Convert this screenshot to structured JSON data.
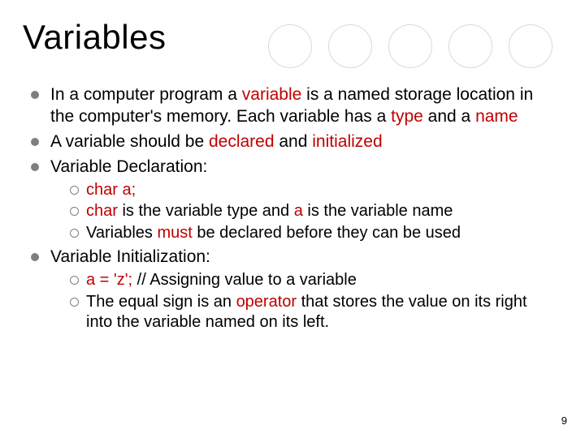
{
  "title": "Variables",
  "circles_count": 5,
  "bullets": [
    {
      "segments": [
        {
          "t": "In a computer program a "
        },
        {
          "t": "variable",
          "red": true
        },
        {
          "t": " is a named storage location in the computer's memory. Each variable has a "
        },
        {
          "t": "type",
          "red": true
        },
        {
          "t": " and a "
        },
        {
          "t": "name",
          "red": true
        }
      ]
    },
    {
      "segments": [
        {
          "t": "A variable should be "
        },
        {
          "t": "declared",
          "red": true
        },
        {
          "t": " and "
        },
        {
          "t": "initialized",
          "red": true
        }
      ]
    },
    {
      "segments": [
        {
          "t": "Variable Declaration:"
        }
      ],
      "sub": [
        {
          "segments": [
            {
              "t": "char a;",
              "red": true
            }
          ]
        },
        {
          "segments": [
            {
              "t": "char",
              "red": true
            },
            {
              "t": " is the variable type and "
            },
            {
              "t": "a",
              "red": true
            },
            {
              "t": " is the variable name"
            }
          ]
        },
        {
          "segments": [
            {
              "t": "Variables "
            },
            {
              "t": "must",
              "red": true
            },
            {
              "t": " be declared before they can be used"
            }
          ]
        }
      ]
    },
    {
      "segments": [
        {
          "t": "Variable Initialization:"
        }
      ],
      "sub": [
        {
          "segments": [
            {
              "t": "a = 'z'; ",
              "red": true
            },
            {
              "t": "// Assigning value to a variable"
            }
          ]
        },
        {
          "segments": [
            {
              "t": "The equal sign is an "
            },
            {
              "t": "operator",
              "red": true
            },
            {
              "t": " that stores the value on its right into the variable named on its left."
            }
          ]
        }
      ]
    }
  ],
  "page_number": "9"
}
